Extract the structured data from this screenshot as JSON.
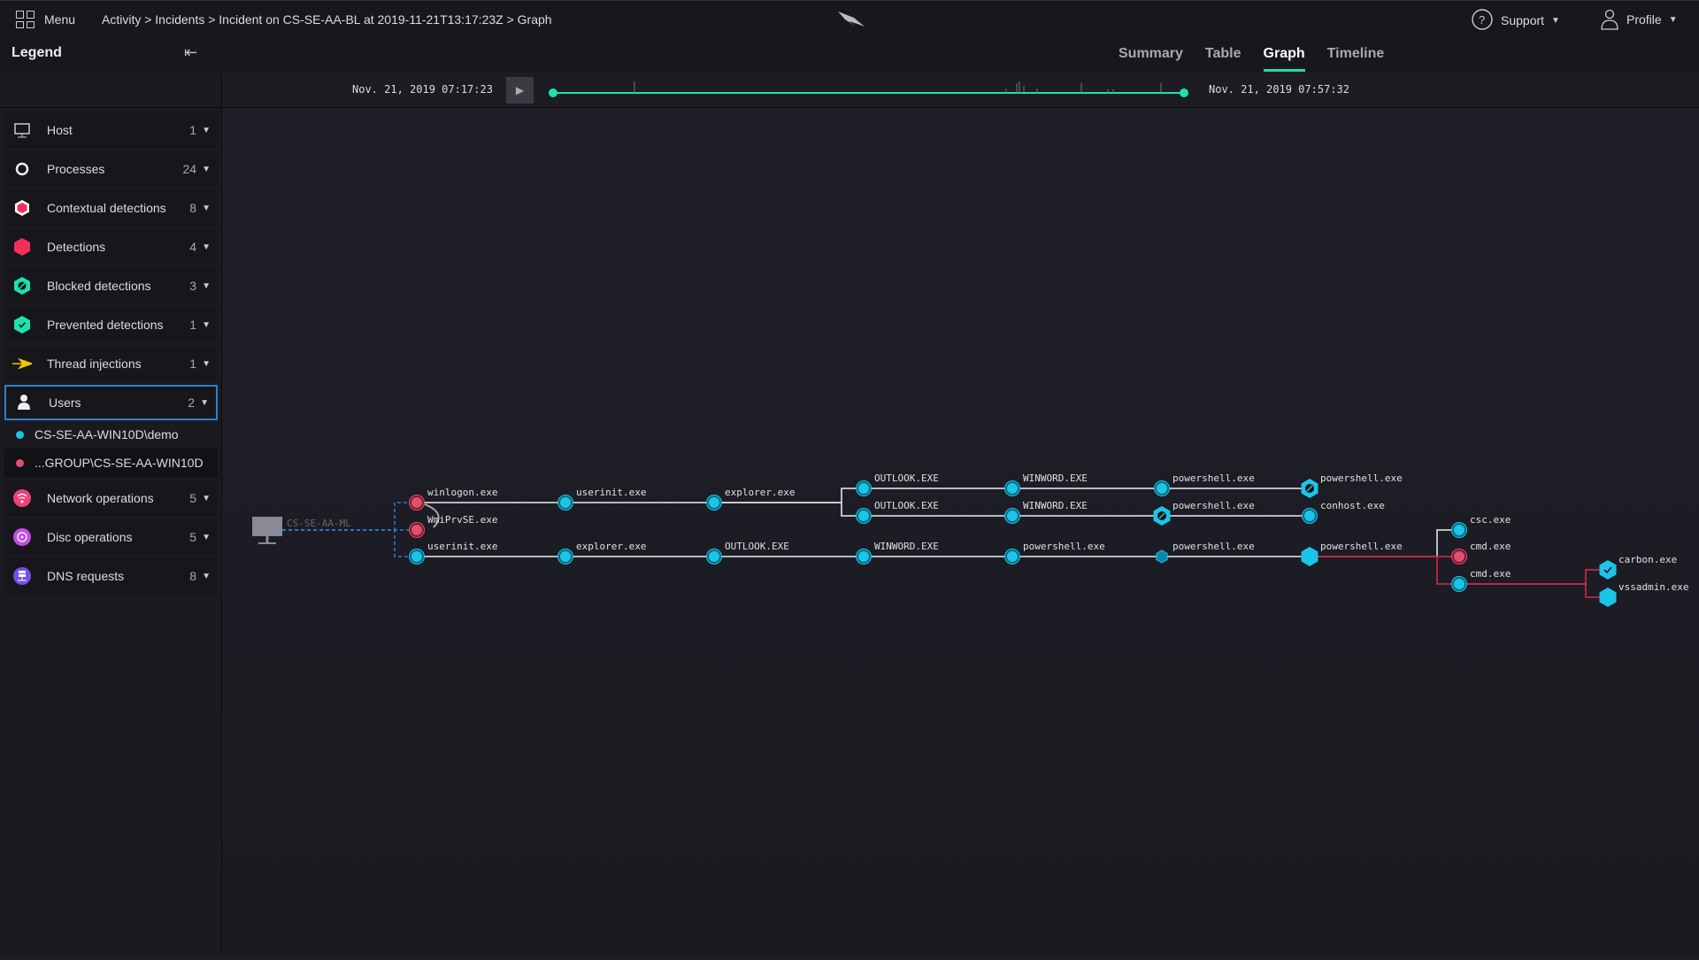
{
  "header": {
    "menu_label": "Menu",
    "breadcrumb": "Activity > Incidents > Incident on CS-SE-AA-BL at 2019-11-21T13:17:23Z > Graph",
    "support_label": "Support",
    "profile_label": "Profile"
  },
  "legend": {
    "title": "Legend",
    "items": [
      {
        "label": "Host",
        "count": "1",
        "icon": "monitor-icon",
        "color": "#cccccc"
      },
      {
        "label": "Processes",
        "count": "24",
        "icon": "process-circle-icon",
        "color": "#eeeeee"
      },
      {
        "label": "Contextual detections",
        "count": "8",
        "icon": "contextual-hexagon-icon",
        "color": "#f0305a"
      },
      {
        "label": "Detections",
        "count": "4",
        "icon": "detection-hexagon-icon",
        "color": "#f0305a"
      },
      {
        "label": "Blocked detections",
        "count": "3",
        "icon": "blocked-hexagon-icon",
        "color": "#1ee1b0"
      },
      {
        "label": "Prevented detections",
        "count": "1",
        "icon": "prevented-hexagon-icon",
        "color": "#1ee1b0"
      },
      {
        "label": "Thread injections",
        "count": "1",
        "icon": "arrow-icon",
        "color": "#f5c400"
      },
      {
        "label": "Users",
        "count": "2",
        "icon": "user-icon",
        "color": "#eeeeee"
      }
    ],
    "users": [
      {
        "label": "CS-SE-AA-WIN10D\\demo",
        "color": "#1cc4e8"
      },
      {
        "label": "...GROUP\\CS-SE-AA-WIN10D",
        "color": "#e0506e"
      }
    ],
    "items_after": [
      {
        "label": "Network operations",
        "count": "5",
        "icon": "wifi-icon",
        "color": "#f0407a"
      },
      {
        "label": "Disc operations",
        "count": "5",
        "icon": "disc-icon",
        "color": "#c050e0"
      },
      {
        "label": "DNS requests",
        "count": "8",
        "icon": "dns-server-icon",
        "color": "#7050e8"
      }
    ]
  },
  "tabs": [
    {
      "label": "Summary"
    },
    {
      "label": "Table"
    },
    {
      "label": "Graph",
      "active": true
    },
    {
      "label": "Timeline"
    }
  ],
  "timeline": {
    "start": "Nov. 21, 2019 07:17:23",
    "end": "Nov. 21, 2019 07:57:32",
    "accent": "#1ee1b0"
  },
  "graph": {
    "host": "CS-SE-AA-ML",
    "nodes": [
      {
        "label": "winlogon.exe",
        "type": "user2"
      },
      {
        "label": "WmiPrvSE.exe",
        "type": "user2"
      },
      {
        "label": "userinit.exe",
        "type": "process"
      },
      {
        "label": "userinit.exe",
        "type": "process"
      },
      {
        "label": "explorer.exe",
        "type": "process"
      },
      {
        "label": "OUTLOOK.EXE",
        "type": "process"
      },
      {
        "label": "OUTLOOK.EXE",
        "type": "process"
      },
      {
        "label": "WINWORD.EXE",
        "type": "process"
      },
      {
        "label": "WINWORD.EXE",
        "type": "process"
      },
      {
        "label": "powershell.exe",
        "type": "process"
      },
      {
        "label": "powershell.exe",
        "type": "blocked"
      },
      {
        "label": "powershell.exe",
        "type": "blocked"
      },
      {
        "label": "conhost.exe",
        "type": "process"
      },
      {
        "label": "explorer.exe",
        "type": "process"
      },
      {
        "label": "OUTLOOK.EXE",
        "type": "process"
      },
      {
        "label": "WINWORD.EXE",
        "type": "process"
      },
      {
        "label": "powershell.exe",
        "type": "process"
      },
      {
        "label": "powershell.exe",
        "type": "contextual"
      },
      {
        "label": "powershell.exe",
        "type": "detection"
      },
      {
        "label": "csc.exe",
        "type": "process"
      },
      {
        "label": "cmd.exe",
        "type": "user2"
      },
      {
        "label": "cmd.exe",
        "type": "process"
      },
      {
        "label": "carbon.exe",
        "type": "prevented"
      },
      {
        "label": "vssadmin.exe",
        "type": "detection"
      }
    ]
  }
}
